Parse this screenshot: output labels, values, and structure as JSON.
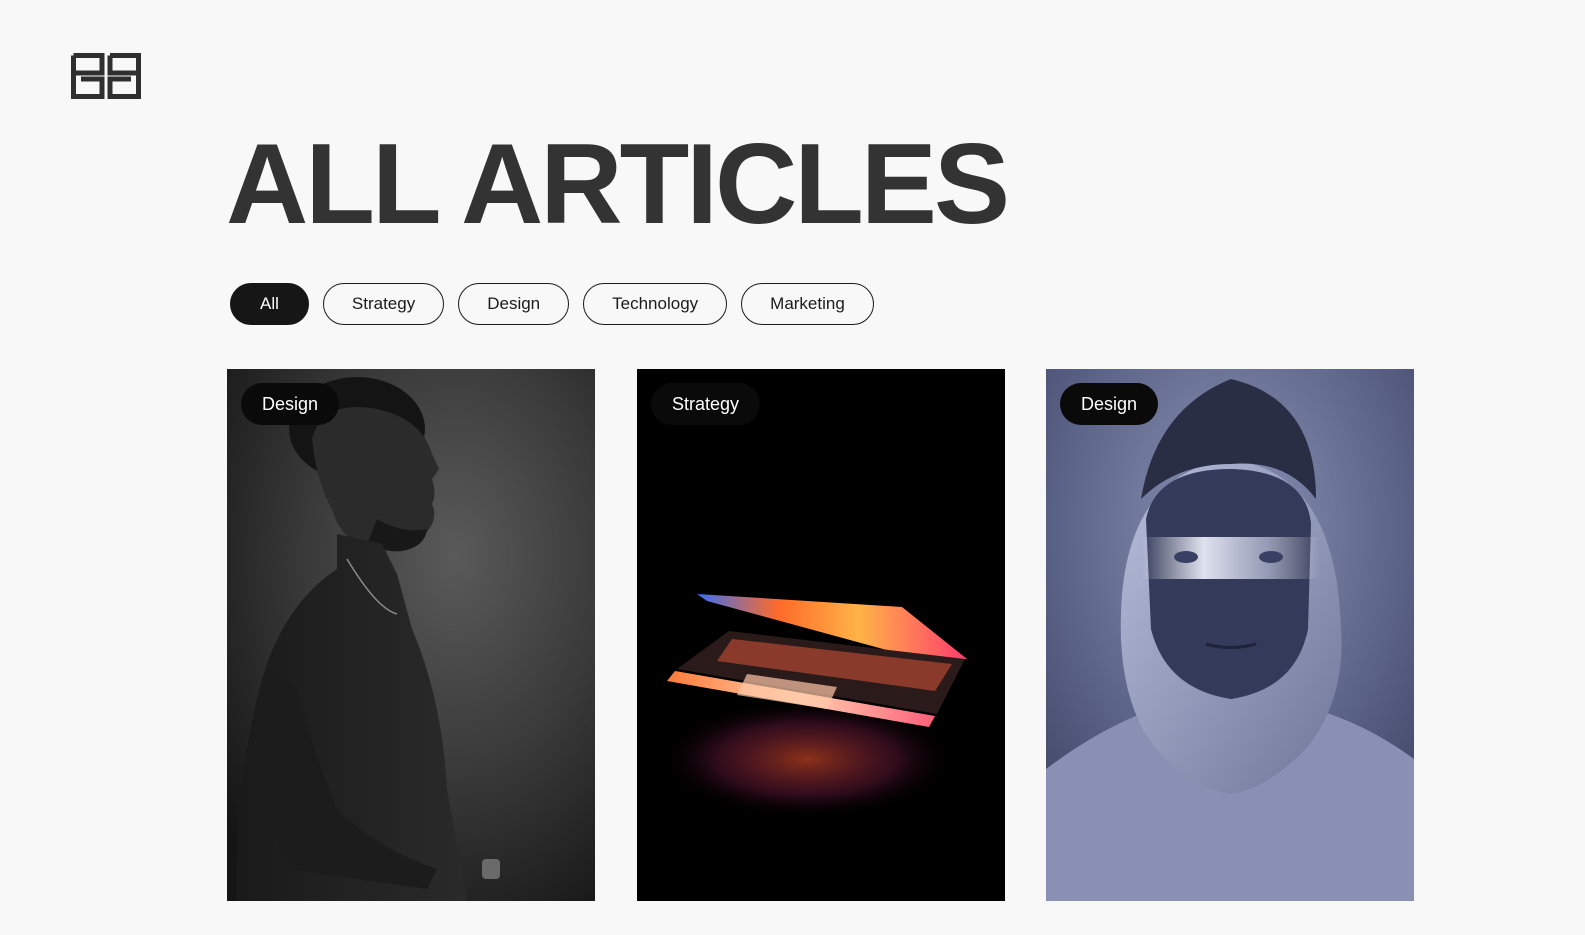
{
  "header": {
    "logo_icon": "ea-monogram-logo",
    "title": "ALL ARTICLES"
  },
  "filters": [
    {
      "label": "All",
      "active": true
    },
    {
      "label": "Strategy",
      "active": false
    },
    {
      "label": "Design",
      "active": false
    },
    {
      "label": "Technology",
      "active": false
    },
    {
      "label": "Marketing",
      "active": false
    }
  ],
  "articles": [
    {
      "category": "Design",
      "image": "portrait-man-profile-monochrome"
    },
    {
      "category": "Strategy",
      "image": "glowing-laptop-on-black"
    },
    {
      "category": "Design",
      "image": "hooded-person-light-across-eyes"
    }
  ],
  "colors": {
    "background": "#f8f8f8",
    "text": "#333333",
    "chip_active_bg": "#161616",
    "badge_bg": "#0a0a0a"
  }
}
